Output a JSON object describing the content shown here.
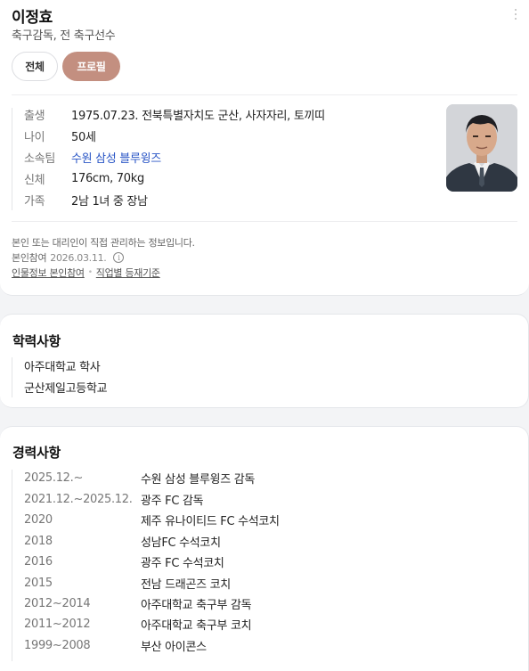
{
  "profile": {
    "name": "이정효",
    "subtitle": "축구감독, 전 축구선수",
    "tabs": [
      {
        "label": "전체",
        "active": false
      },
      {
        "label": "프로필",
        "active": true
      }
    ],
    "info": [
      {
        "label": "출생",
        "value": "1975.07.23. 전북특별자치도 군산, 사자자리, 토끼띠"
      },
      {
        "label": "나이",
        "value": "50세"
      },
      {
        "label": "소속팀",
        "value": "수원 삼성 블루윙즈"
      },
      {
        "label": "신체",
        "value": "176cm, 70kg"
      },
      {
        "label": "가족",
        "value": "2남 1녀 중 장남"
      }
    ],
    "notice": {
      "text": "본인 또는 대리인이 직접 관리하는 정보입니다.",
      "date_label": "본인참여",
      "date_value": "2026.03.11.",
      "link1": "인물정보 본인참여",
      "link2": "직업별 등재기준"
    }
  },
  "education": {
    "title": "학력사항",
    "items": [
      "아주대학교 학사",
      "군산제일고등학교"
    ]
  },
  "career": {
    "title": "경력사항",
    "items": [
      {
        "period": "2025.12.~",
        "desc": "수원 삼성 블루윙즈 감독"
      },
      {
        "period": "2021.12.~2025.12.",
        "desc": "광주 FC 감독"
      },
      {
        "period": "2020",
        "desc": "제주 유나이티드 FC 수석코치"
      },
      {
        "period": "2018",
        "desc": "성남FC 수석코치"
      },
      {
        "period": "2016",
        "desc": "광주 FC 수석코치"
      },
      {
        "period": "2015",
        "desc": "전남 드래곤즈 코치"
      },
      {
        "period": "2012~2014",
        "desc": "아주대학교 축구부 감독"
      },
      {
        "period": "2011~2012",
        "desc": "아주대학교 축구부 코치"
      },
      {
        "period": "1999~2008",
        "desc": "부산 아이콘스"
      }
    ]
  },
  "colors": {
    "accent": "#c38f80",
    "link": "#2a56c6"
  }
}
